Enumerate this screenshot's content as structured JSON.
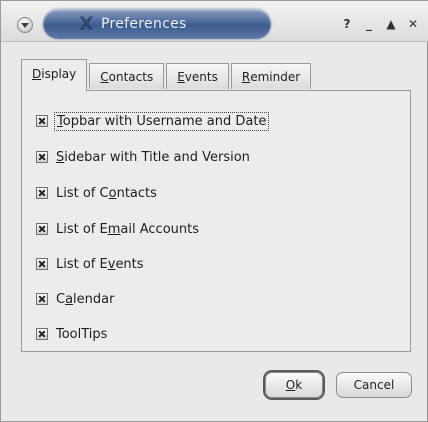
{
  "window": {
    "title": "Preferences",
    "title_glyph": "X"
  },
  "titlebar_buttons": [
    {
      "name": "help",
      "glyph": "?"
    },
    {
      "name": "minimize",
      "glyph": "_"
    },
    {
      "name": "maximize",
      "glyph": "▲"
    },
    {
      "name": "close",
      "glyph": "✕"
    }
  ],
  "tabs": [
    {
      "mnemonic": "D",
      "rest": "isplay",
      "active": true
    },
    {
      "mnemonic": "C",
      "rest": "ontacts",
      "active": false
    },
    {
      "mnemonic": "E",
      "rest": "vents",
      "active": false
    },
    {
      "mnemonic": "R",
      "rest": "eminder",
      "active": false
    }
  ],
  "options": [
    {
      "pre": "",
      "mnemonic": "T",
      "post": "opbar with Username and Date",
      "checked": true,
      "focused": true
    },
    {
      "pre": "",
      "mnemonic": "S",
      "post": "idebar with Title and Version",
      "checked": true,
      "focused": false
    },
    {
      "pre": "List of C",
      "mnemonic": "o",
      "post": "ntacts",
      "checked": true,
      "focused": false
    },
    {
      "pre": "List of E",
      "mnemonic": "m",
      "post": "ail Accounts",
      "checked": true,
      "focused": false
    },
    {
      "pre": "List of E",
      "mnemonic": "v",
      "post": "ents",
      "checked": true,
      "focused": false
    },
    {
      "pre": "C",
      "mnemonic": "a",
      "post": "lendar",
      "checked": true,
      "focused": false
    },
    {
      "pre": "ToolTips",
      "mnemonic": "",
      "post": "",
      "checked": true,
      "focused": false
    }
  ],
  "buttons": {
    "ok": {
      "mnemonic": "O",
      "rest": "k"
    },
    "cancel": {
      "label": "Cancel"
    }
  },
  "colors": {
    "title_pill": "#3e5b8e",
    "window_bg": "#e9e9e9"
  }
}
